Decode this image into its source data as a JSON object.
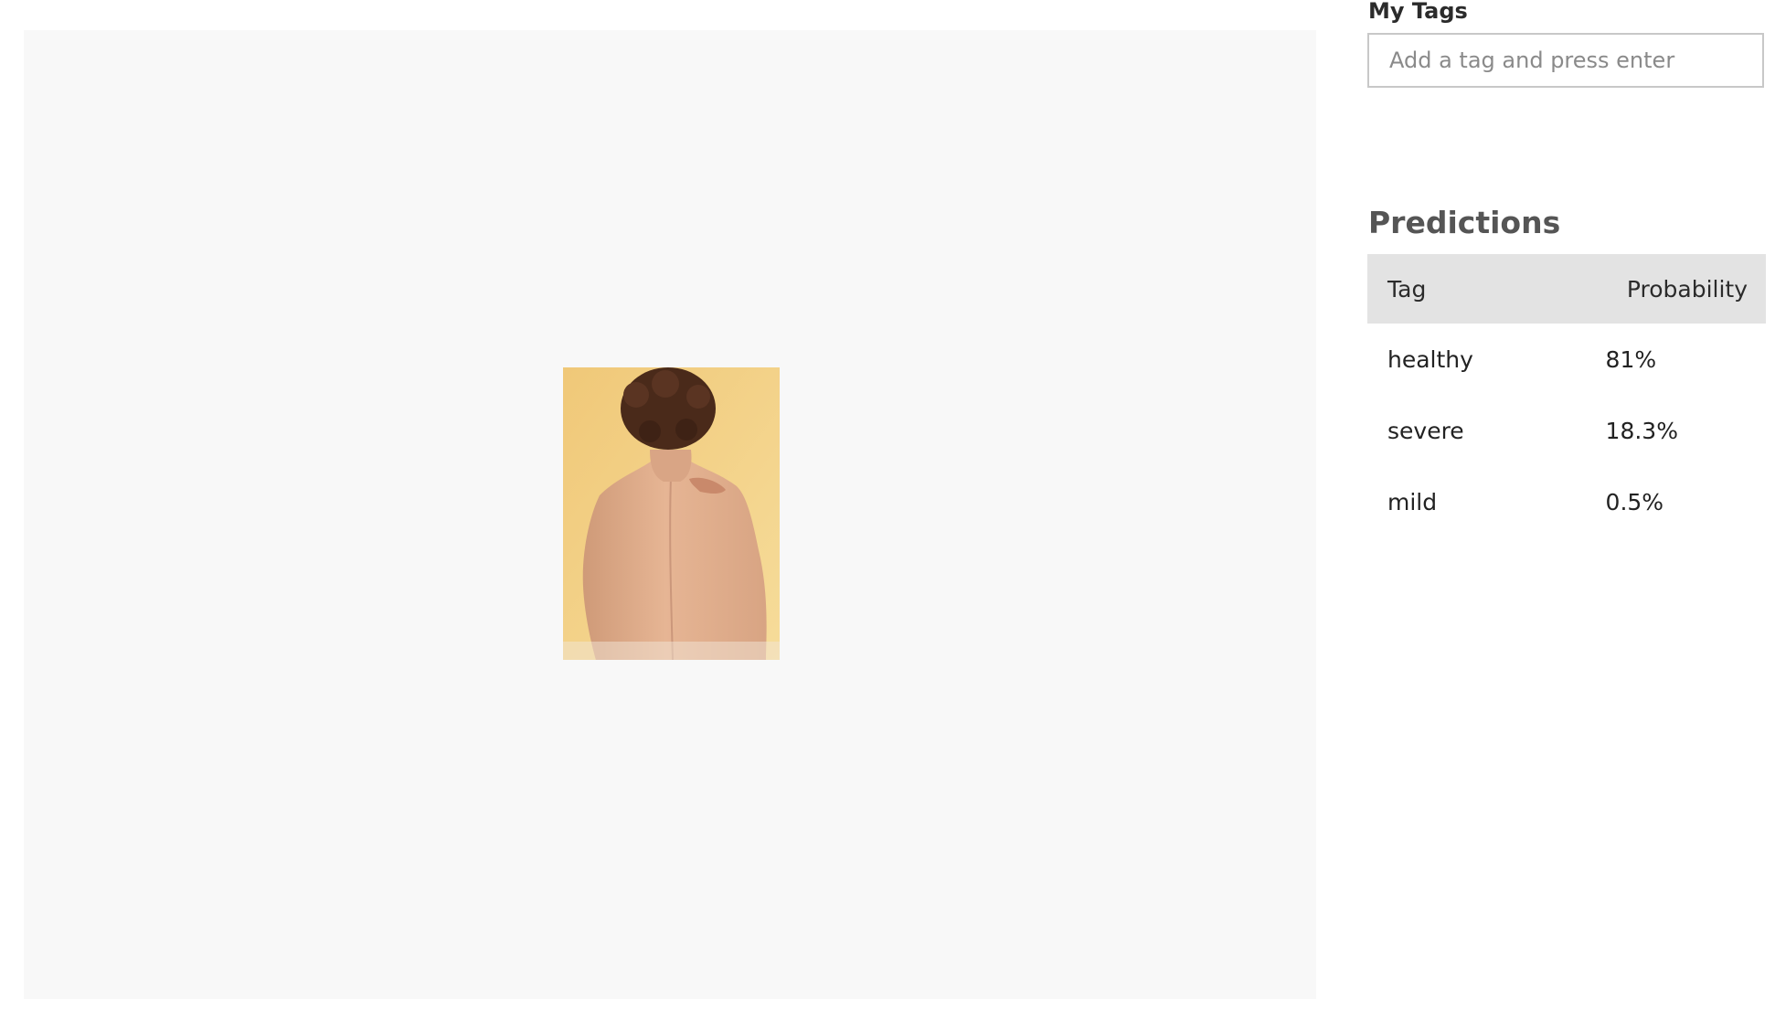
{
  "my_tags": {
    "heading": "My Tags",
    "input_placeholder": "Add a tag and press enter",
    "input_value": ""
  },
  "predictions": {
    "heading": "Predictions",
    "columns": {
      "tag": "Tag",
      "probability": "Probability"
    },
    "rows": [
      {
        "tag": "healthy",
        "probability": "81%"
      },
      {
        "tag": "severe",
        "probability": "18.3%"
      },
      {
        "tag": "mild",
        "probability": "0.5%"
      }
    ]
  },
  "colors": {
    "viewer_background": "#f8f8f8",
    "table_header_background": "#e3e3e3",
    "input_border": "#c8c8c8"
  }
}
